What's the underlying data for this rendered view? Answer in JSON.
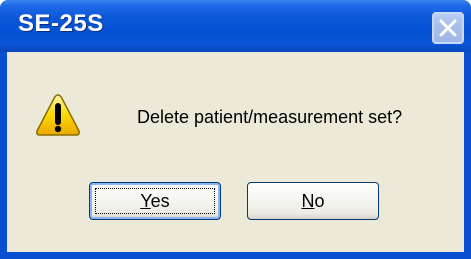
{
  "window": {
    "title": "SE-25S"
  },
  "dialog": {
    "icon": "warning-icon",
    "message": "Delete patient/measurement set?"
  },
  "buttons": {
    "yes": {
      "mnemonic": "Y",
      "rest": "es"
    },
    "no": {
      "mnemonic": "N",
      "rest": "o"
    }
  },
  "colors": {
    "titlebar": "#0652d4",
    "client_bg": "#ece9d8",
    "button_border": "#003c74",
    "warning_fill": "#ffd800"
  }
}
